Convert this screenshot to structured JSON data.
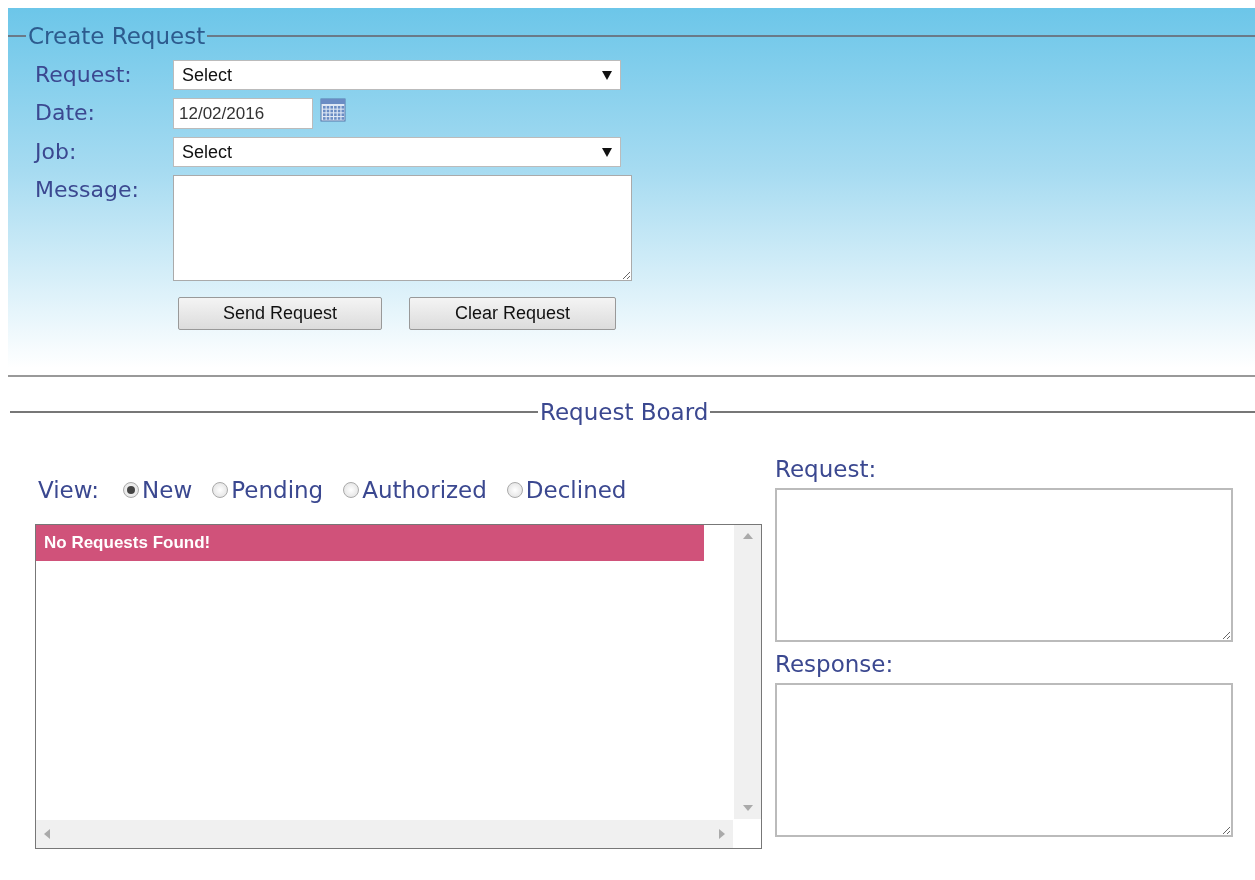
{
  "create_request": {
    "title": "Create Request",
    "fields": [
      {
        "kind": "select",
        "label": "Request:",
        "value": "Select"
      },
      {
        "kind": "date",
        "label": "Date:",
        "value": "12/02/2016"
      },
      {
        "kind": "select",
        "label": "Job:",
        "value": "Select"
      },
      {
        "kind": "textarea",
        "label": "Message:"
      }
    ],
    "buttons": [
      "Send Request",
      "Clear Request"
    ]
  },
  "request_board": {
    "title": "Request Board",
    "view_label": "View:",
    "views": [
      {
        "label": "New",
        "selected": true
      },
      {
        "label": "Pending",
        "selected": false
      },
      {
        "label": "Authorized",
        "selected": false
      },
      {
        "label": "Declined",
        "selected": false
      }
    ],
    "list": {
      "message": "No Requests Found!"
    },
    "details": [
      {
        "label": "Request:"
      },
      {
        "label": "Response:"
      }
    ]
  }
}
